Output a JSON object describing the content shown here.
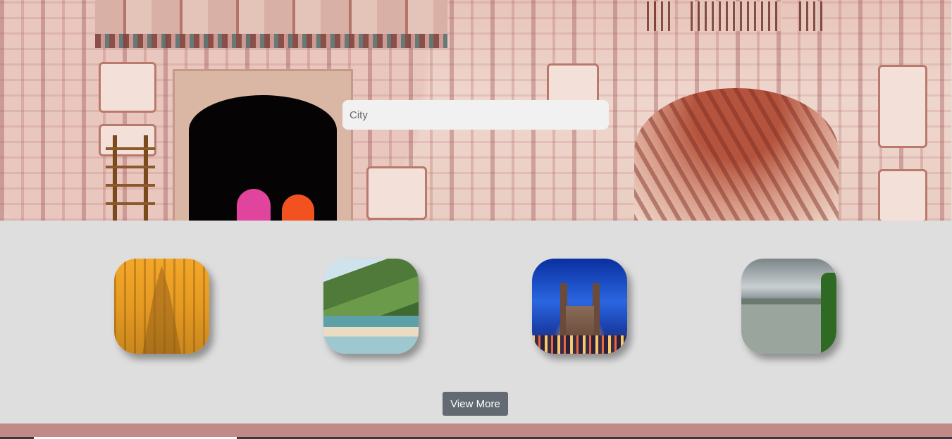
{
  "search": {
    "placeholder": "City",
    "value": ""
  },
  "gallery": {
    "cities": [
      {
        "image": "golden-tower-photo"
      },
      {
        "image": "beach-coastline-photo"
      },
      {
        "image": "charminar-night-photo"
      },
      {
        "image": "lake-palace-photo"
      }
    ],
    "view_more_label": "View More"
  },
  "colors": {
    "page_background": "#dedede",
    "button_background": "#636a72",
    "footer_band": "#c08a87",
    "footer_strip": "#343a40"
  }
}
